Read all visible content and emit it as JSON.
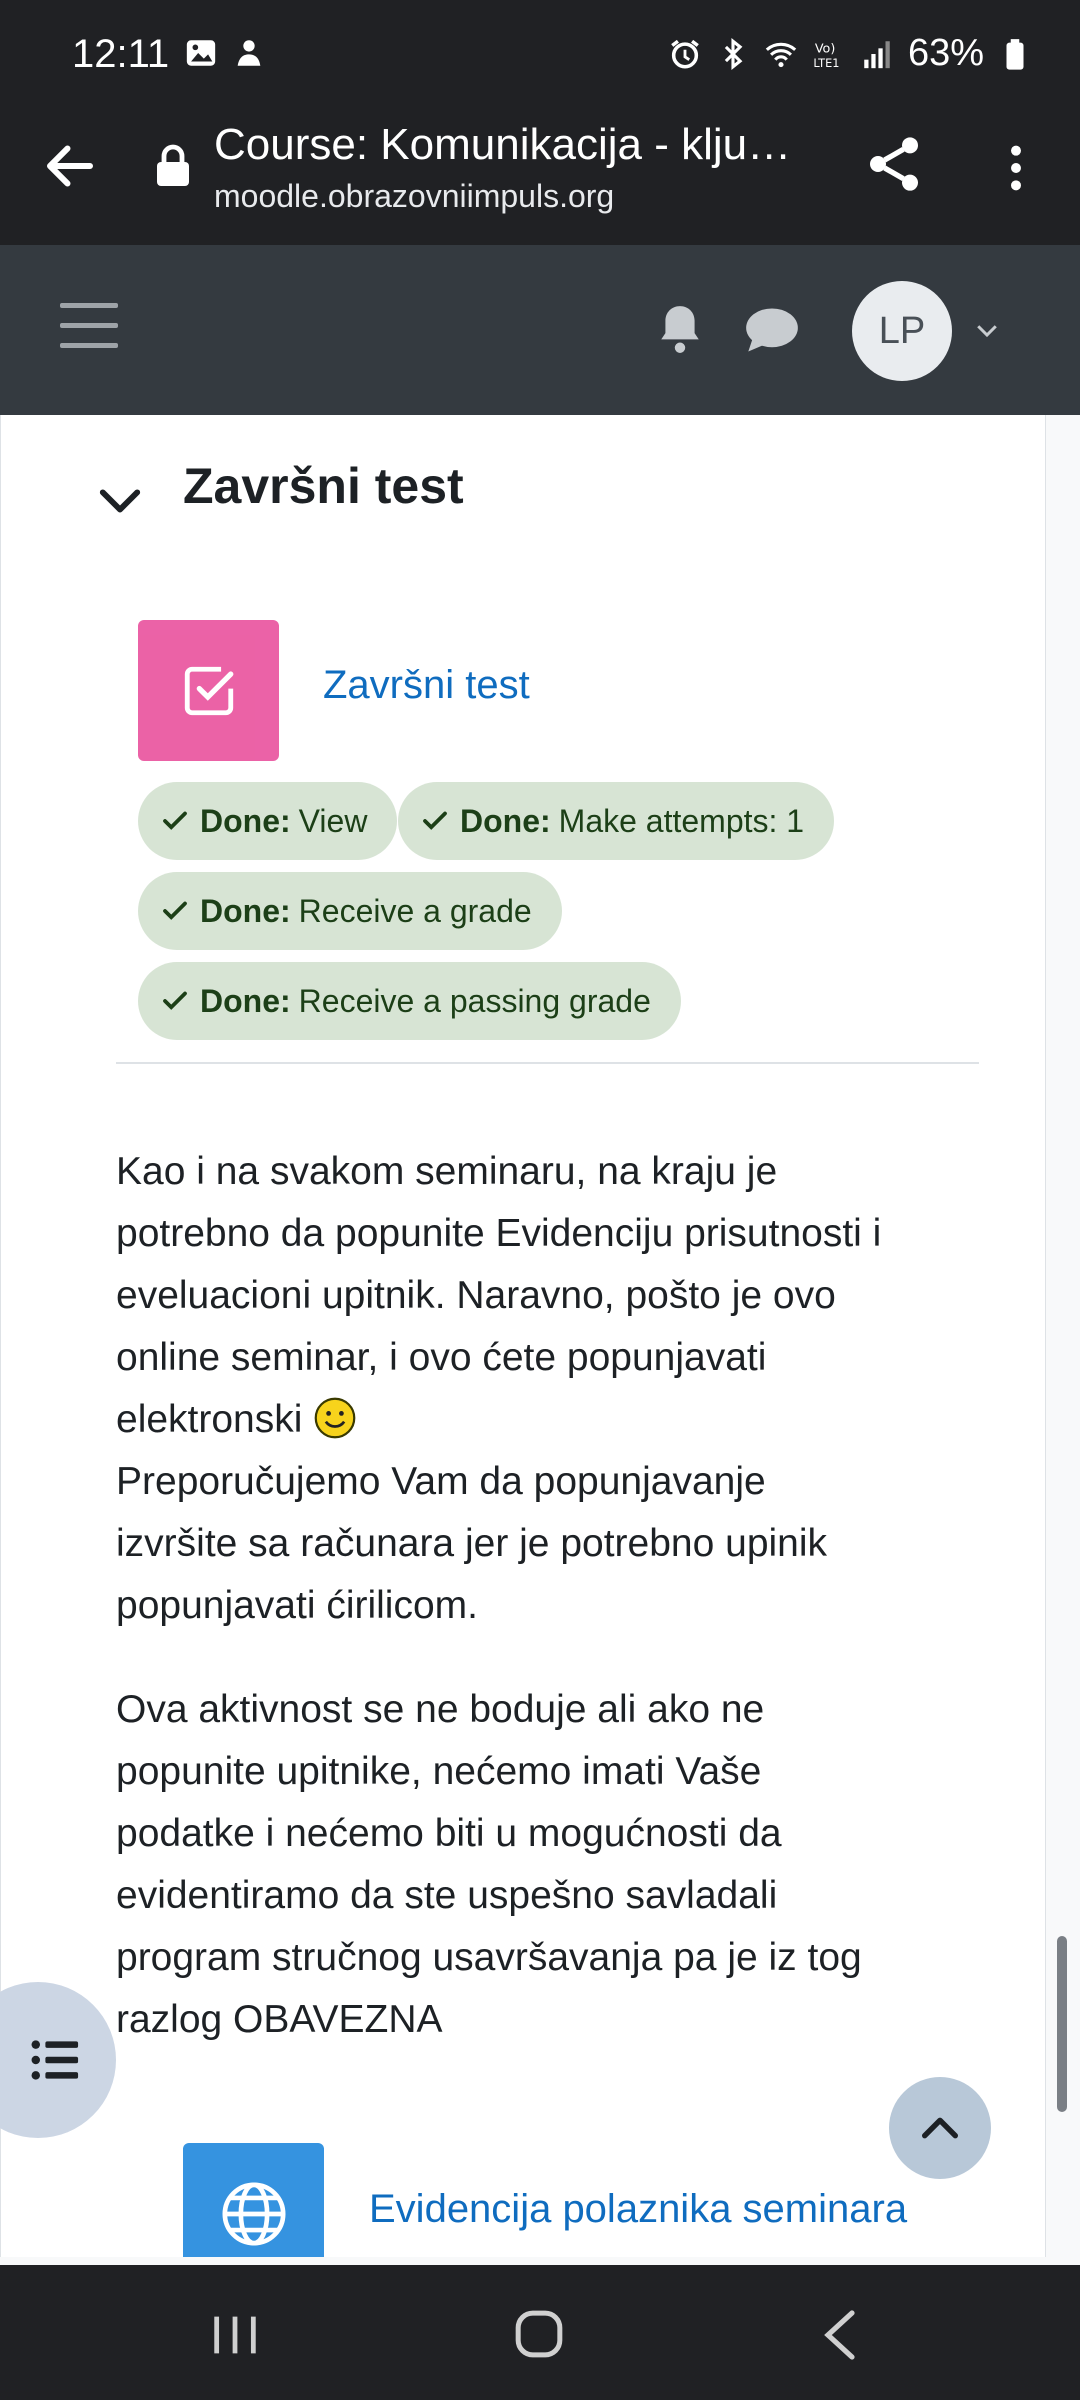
{
  "status_bar": {
    "time": "12:11",
    "battery": "63%",
    "icons": [
      "gallery-icon",
      "app-notification-icon",
      "alarm-icon",
      "bluetooth-icon",
      "wifi-icon",
      "volte-icon",
      "signal-icon",
      "battery-icon"
    ]
  },
  "browser": {
    "title": "Course: Komunikacija - klju…",
    "url": "moodle.obrazovniimpuls.org"
  },
  "navbar": {
    "avatar_initials": "LP"
  },
  "section": {
    "title": "Završni test"
  },
  "activity": {
    "name": "Završni test",
    "icon_color": "#ea5aa2",
    "completion": [
      {
        "prefix": "Done:",
        "text": "View"
      },
      {
        "prefix": "Done:",
        "text": "Make attempts: 1"
      },
      {
        "prefix": "Done:",
        "text": "Receive a grade"
      },
      {
        "prefix": "Done:",
        "text": "Receive a passing grade"
      }
    ]
  },
  "paragraphs": {
    "p1_before": "Kao i na svakom seminaru, na kraju je potrebno da popunite Evidenciju prisutnosti i eveluacioni upitnik. Naravno, pošto je ovo online seminar, i ovo ćete popunjavati elektronski",
    "p1_after": "Preporučujemo Vam da popunjavanje izvršite sa računara jer je potrebno upinik popunjavati ćirilicom.",
    "p2": "Ova aktivnost se ne boduje ali ako ne popunite upitnike, nećemo imati Vaše podatke i nećemo biti u mogućnosti da evidentiramo da ste uspešno savladali program stručnog usavršavanja pa je iz tog razlog OBAVEZNA"
  },
  "activity2": {
    "name": "Evidencija polaznika seminara",
    "icon_color": "#3593e0"
  },
  "colors": {
    "link": "#0f6cbf",
    "badge_bg": "#d7e4d4",
    "navbar": "#343a40"
  }
}
